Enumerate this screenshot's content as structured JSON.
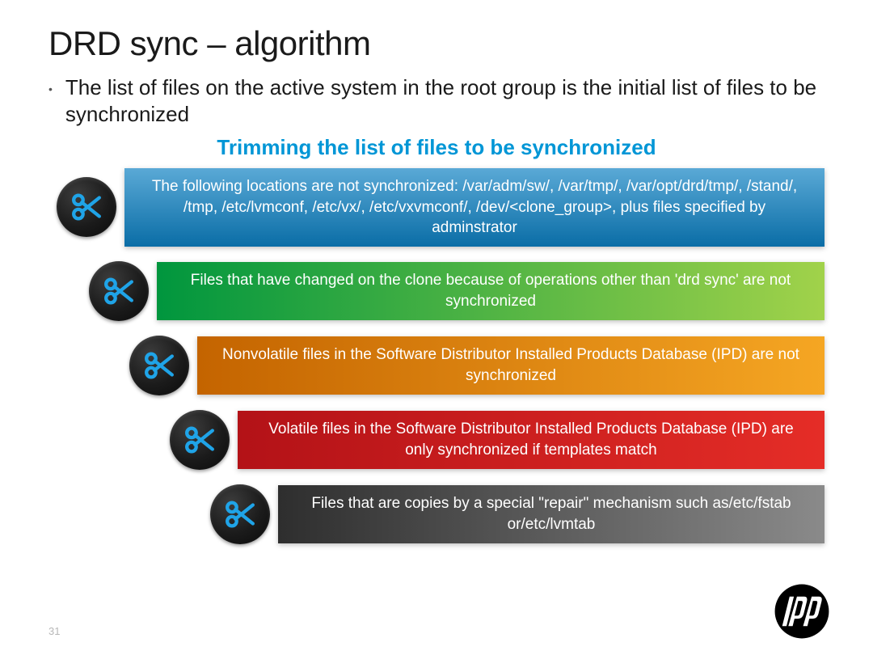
{
  "title": "DRD sync – algorithm",
  "bullet": "The list of files on the active system in the root group is the initial list of files to be synchronized",
  "subtitle": "Trimming the list of files to be synchronized",
  "bars": {
    "blue": "The following locations are not synchronized: /var/adm/sw/, /var/tmp/, /var/opt/drd/tmp/, /stand/, /tmp, /etc/lvmconf, /etc/vx/, /etc/vxvmconf/, /dev/<clone_group>, plus files specified by adminstrator",
    "green": "Files that have changed on the clone because of operations other than 'drd sync' are not synchronized",
    "orange": "Nonvolatile files in the Software Distributor Installed Products Database (IPD) are not synchronized",
    "red": "Volatile files in the Software Distributor Installed Products Database (IPD) are only synchronized if templates match",
    "gray": "Files that are copies by a special \"repair\" mechanism such as/etc/fstab or/etc/lvmtab"
  },
  "pageNumber": "31",
  "logoName": "hp"
}
